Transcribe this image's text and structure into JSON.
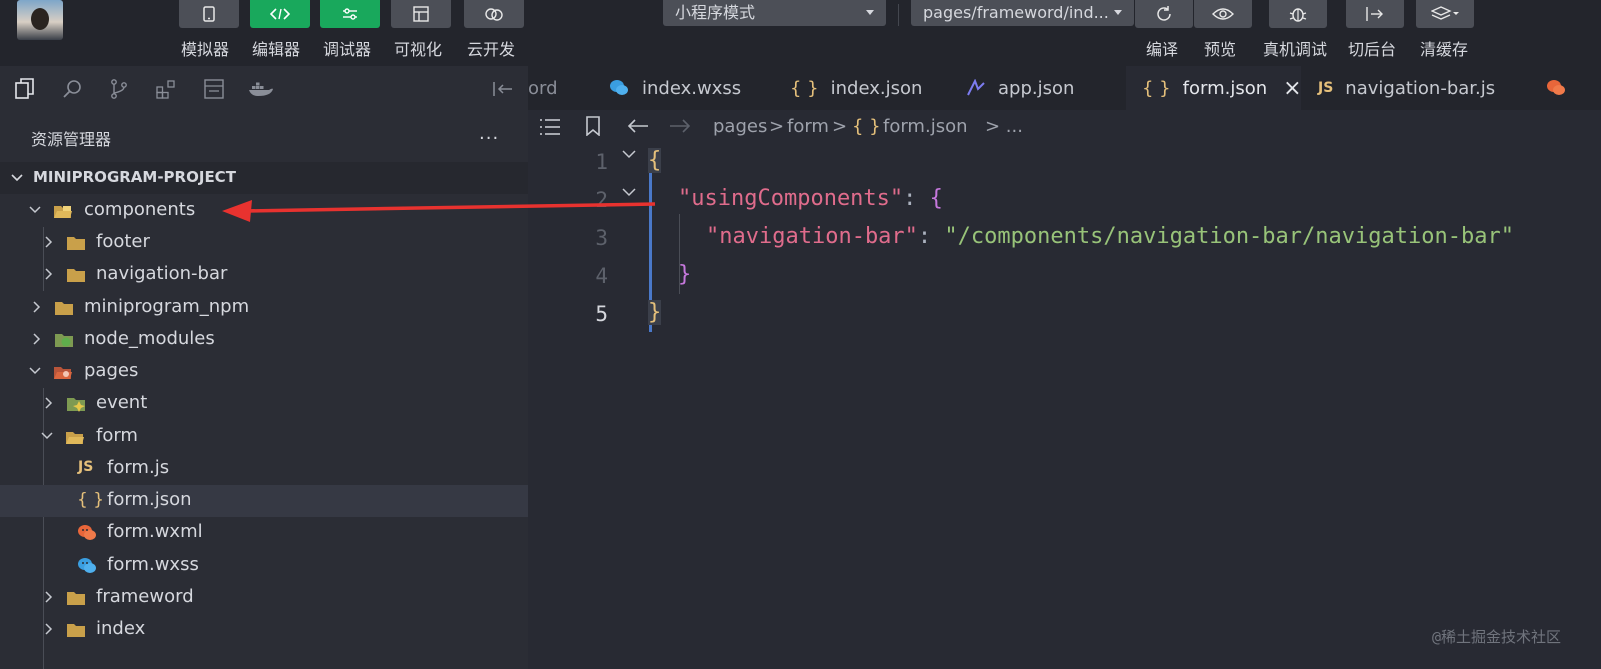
{
  "toolbar": {
    "left_buttons": [
      {
        "label": "模拟器",
        "icon": "phone-icon"
      },
      {
        "label": "编辑器",
        "icon": "code-icon"
      },
      {
        "label": "调试器",
        "icon": "sliders-icon"
      },
      {
        "label": "可视化",
        "icon": "layout-icon"
      },
      {
        "label": "云开发",
        "icon": "cloud-icon"
      }
    ],
    "mode_select": "小程序模式",
    "page_select": "pages/frameword/ind...",
    "right_buttons": [
      {
        "label": "编译",
        "icon": "refresh-icon"
      },
      {
        "label": "预览",
        "icon": "eye-icon"
      },
      {
        "label": "真机调试",
        "icon": "bug-icon"
      },
      {
        "label": "切后台",
        "icon": "switch-icon"
      },
      {
        "label": "清缓存",
        "icon": "layers-icon"
      }
    ]
  },
  "sidebar": {
    "title": "资源管理器",
    "more": "...",
    "project": "MINIPROGRAM-PROJECT",
    "tree": [
      {
        "label": "components",
        "expanded": true
      },
      {
        "label": "footer",
        "expanded": false
      },
      {
        "label": "navigation-bar",
        "expanded": false
      },
      {
        "label": "miniprogram_npm",
        "expanded": false
      },
      {
        "label": "node_modules",
        "expanded": false
      },
      {
        "label": "pages",
        "expanded": true
      },
      {
        "label": "event",
        "expanded": false
      },
      {
        "label": "form",
        "expanded": true
      },
      {
        "label": "form.js",
        "badge": "JS"
      },
      {
        "label": "form.json",
        "badge": "{ }",
        "selected": true
      },
      {
        "label": "form.wxml"
      },
      {
        "label": "form.wxss"
      },
      {
        "label": "frameword",
        "expanded": false
      },
      {
        "label": "index",
        "expanded": false
      }
    ]
  },
  "tabs": [
    {
      "label": "ord"
    },
    {
      "label": "index.wxss"
    },
    {
      "label": "index.json",
      "badge": "{ }"
    },
    {
      "label": "app.json"
    },
    {
      "label": "form.json",
      "badge": "{ }",
      "active": true,
      "close": "×"
    },
    {
      "label": "navigation-bar.js",
      "badge": "JS"
    }
  ],
  "breadcrumb": {
    "part1": "pages",
    "sep": ">",
    "part2": "form",
    "badge": "{ }",
    "part3": "form.json",
    "tail": "> ..."
  },
  "code": {
    "line_numbers": [
      "1",
      "2",
      "3",
      "4",
      "5"
    ],
    "line1": "{",
    "line2_key": "\"usingComponents\"",
    "line2_colon": ": ",
    "line2_brace": "{",
    "line3_key": "\"navigation-bar\"",
    "line3_colon": ": ",
    "line3_value": "\"/components/navigation-bar/navigation-bar\"",
    "line4": "}",
    "line5": "}"
  },
  "watermark": "@稀土掘金技术社区",
  "colors": {
    "accent_green": "#19a85c",
    "arrow_red": "#e8322f"
  }
}
